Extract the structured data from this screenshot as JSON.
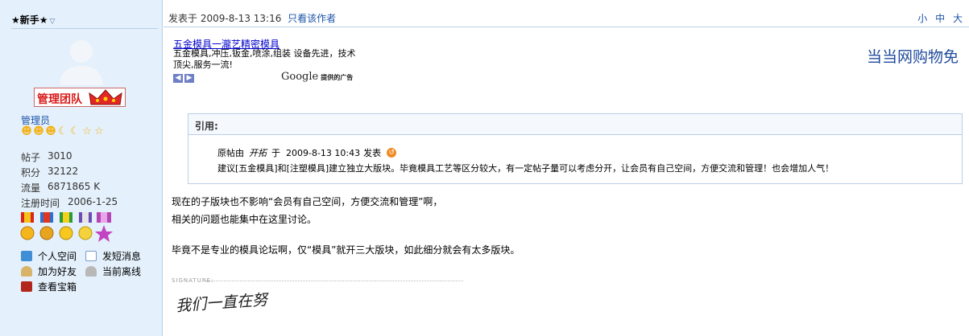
{
  "user": {
    "name": "★新手★",
    "badge_text": "管理团队",
    "role": "管理员",
    "stats": [
      {
        "label": "帖子",
        "value": "3010"
      },
      {
        "label": "积分",
        "value": "32122"
      },
      {
        "label": "流量",
        "value": "6871865 K"
      },
      {
        "label": "注册时间",
        "value": "2006-1-25"
      }
    ],
    "actions": {
      "space": "个人空间",
      "message": "发短消息",
      "add_friend": "加为好友",
      "status": "当前离线",
      "treasure": "查看宝箱"
    }
  },
  "post": {
    "posted_label": "发表于",
    "posted_time": "2009-8-13 13:16",
    "author_only": "只看该作者",
    "font_small": "小",
    "font_medium": "中",
    "font_large": "大"
  },
  "ad": {
    "title": "五金模具一瀧艺精密模具",
    "body": "五金模具,冲压,钣金,喷涂,组装  设备先进，技术顶尖,服务一流!",
    "google": "Google",
    "google_suffix": "提供的广告"
  },
  "dangdang_text": "当当网购物免",
  "quote": {
    "label": "引用:",
    "orig_prefix": "原帖由",
    "orig_author": "开拓",
    "orig_mid": "于",
    "orig_time": "2009-8-13 10:43",
    "orig_suffix": "发表",
    "text": "建议[五金模具]和[注塑模具]建立独立大版块。毕竟模具工艺等区分较大，有一定帖子量可以考虑分开，让会员有自己空间，方便交流和管理！也会增加人气！"
  },
  "body": {
    "line1": "现在的子版块也不影响“会员有自己空间，方便交流和管理”啊，",
    "line2": "相关的问题也能集中在这里讨论。",
    "line3": "毕竟不是专业的模具论坛啊，仅“模具”就开三大版块，如此细分就会有太多版块。"
  },
  "signature": {
    "label": "SIGNATURE:",
    "text": "我们一直在努"
  },
  "colors": {
    "panel_bg": "#e4f0fb",
    "border": "#b9cfe6",
    "link": "#1d54a8",
    "badge_red": "#d81b1b"
  }
}
